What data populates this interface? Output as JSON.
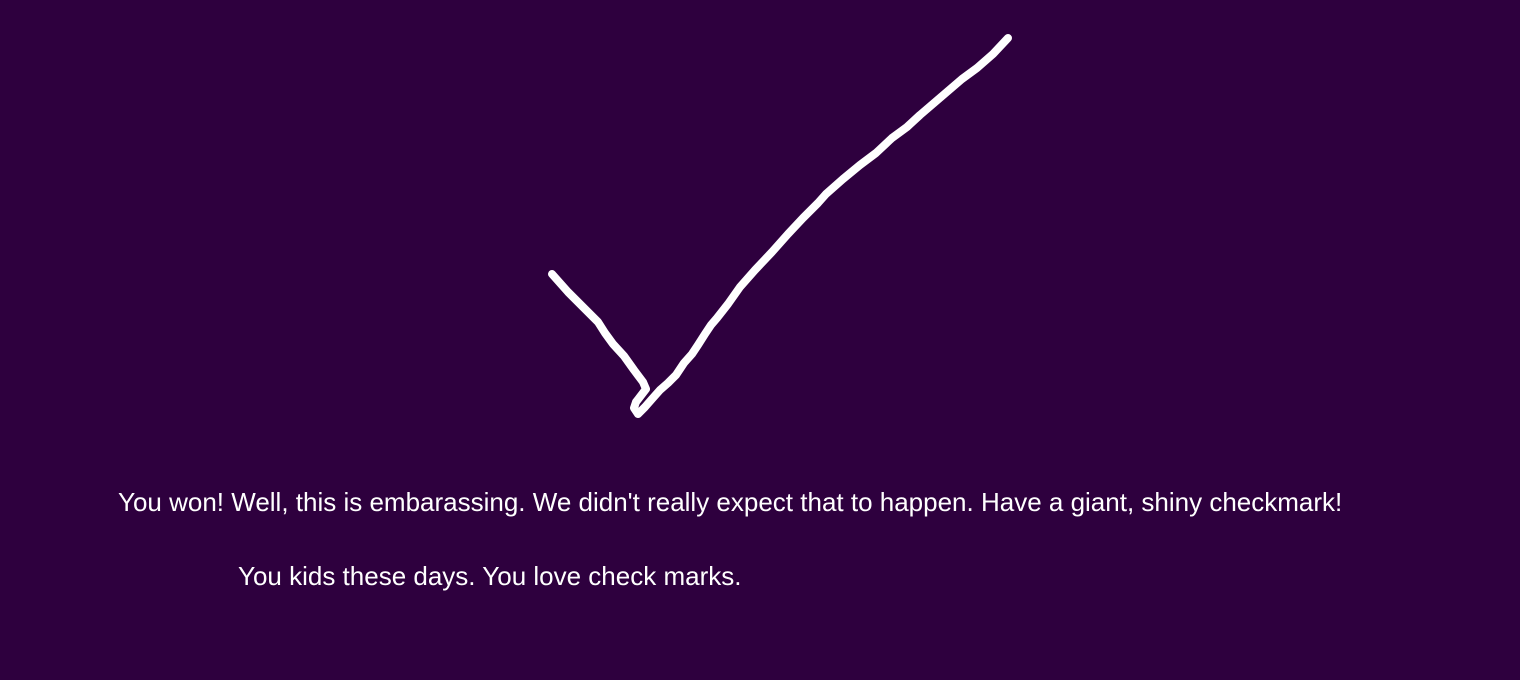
{
  "theme": {
    "background": "#2e003e",
    "foreground": "#ffffff"
  },
  "win_screen": {
    "icon": "checkmark-icon",
    "message": "You won! Well, this is embarassing. We didn't really expect that to happen. Have a giant, shiny checkmark!",
    "quip": "You kids these days. You love check marks."
  }
}
